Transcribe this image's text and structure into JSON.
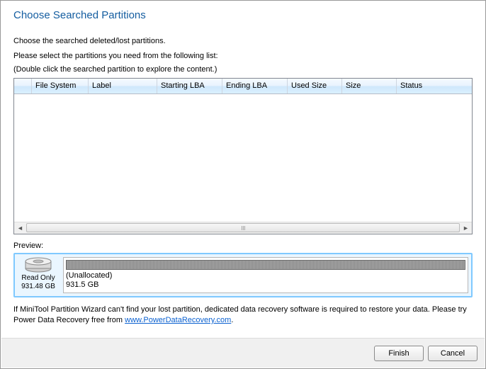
{
  "header": {
    "title": "Choose Searched Partitions"
  },
  "subtitle": "Choose the searched deleted/lost partitions.",
  "instruct_line1": "Please select the partitions you need from the following list:",
  "instruct_line2": "(Double click the searched partition to explore the content.)",
  "columns": {
    "file_system": "File System",
    "label": "Label",
    "starting_lba": "Starting LBA",
    "ending_lba": "Ending LBA",
    "used_size": "Used Size",
    "size": "Size",
    "status": "Status"
  },
  "preview": {
    "label": "Preview:",
    "disk_mode": "Read Only",
    "disk_size": "931.48 GB",
    "partition_name": "(Unallocated)",
    "partition_size": "931.5 GB"
  },
  "tip": {
    "before": "If MiniTool Partition Wizard can't find your lost partition, dedicated data recovery software is required to restore your data. Please try Power Data Recovery free from ",
    "link": "www.PowerDataRecovery.com",
    "after": "."
  },
  "footer": {
    "finish": "Finish",
    "cancel": "Cancel"
  }
}
